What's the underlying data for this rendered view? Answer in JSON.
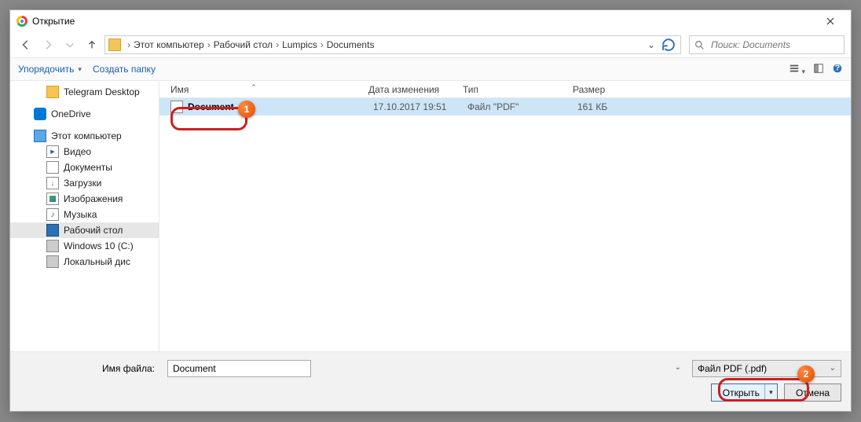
{
  "window": {
    "title": "Открытие"
  },
  "nav": {
    "crumbs": [
      "Этот компьютер",
      "Рабочий стол",
      "Lumpics",
      "Documents"
    ]
  },
  "search": {
    "placeholder": "Поиск: Documents"
  },
  "toolbar": {
    "organize": "Упорядочить",
    "newfolder": "Создать папку"
  },
  "sidebar": {
    "items": [
      {
        "label": "Telegram Desktop"
      },
      {
        "label": "OneDrive"
      },
      {
        "label": "Этот компьютер"
      },
      {
        "label": "Видео"
      },
      {
        "label": "Документы"
      },
      {
        "label": "Загрузки"
      },
      {
        "label": "Изображения"
      },
      {
        "label": "Музыка"
      },
      {
        "label": "Рабочий стол"
      },
      {
        "label": "Windows 10 (C:)"
      },
      {
        "label": "Локальный дис"
      }
    ]
  },
  "columns": {
    "name": "Имя",
    "date": "Дата изменения",
    "type": "Тип",
    "size": "Размер"
  },
  "files": [
    {
      "name": "Document",
      "date": "17.10.2017 19:51",
      "type": "Файл \"PDF\"",
      "size": "161 КБ"
    }
  ],
  "footer": {
    "filename_label": "Имя файла:",
    "filename_value": "Document",
    "filter": "Файл PDF (.pdf)",
    "open": "Открыть",
    "cancel": "Отмена"
  },
  "badges": {
    "one": "1",
    "two": "2"
  }
}
